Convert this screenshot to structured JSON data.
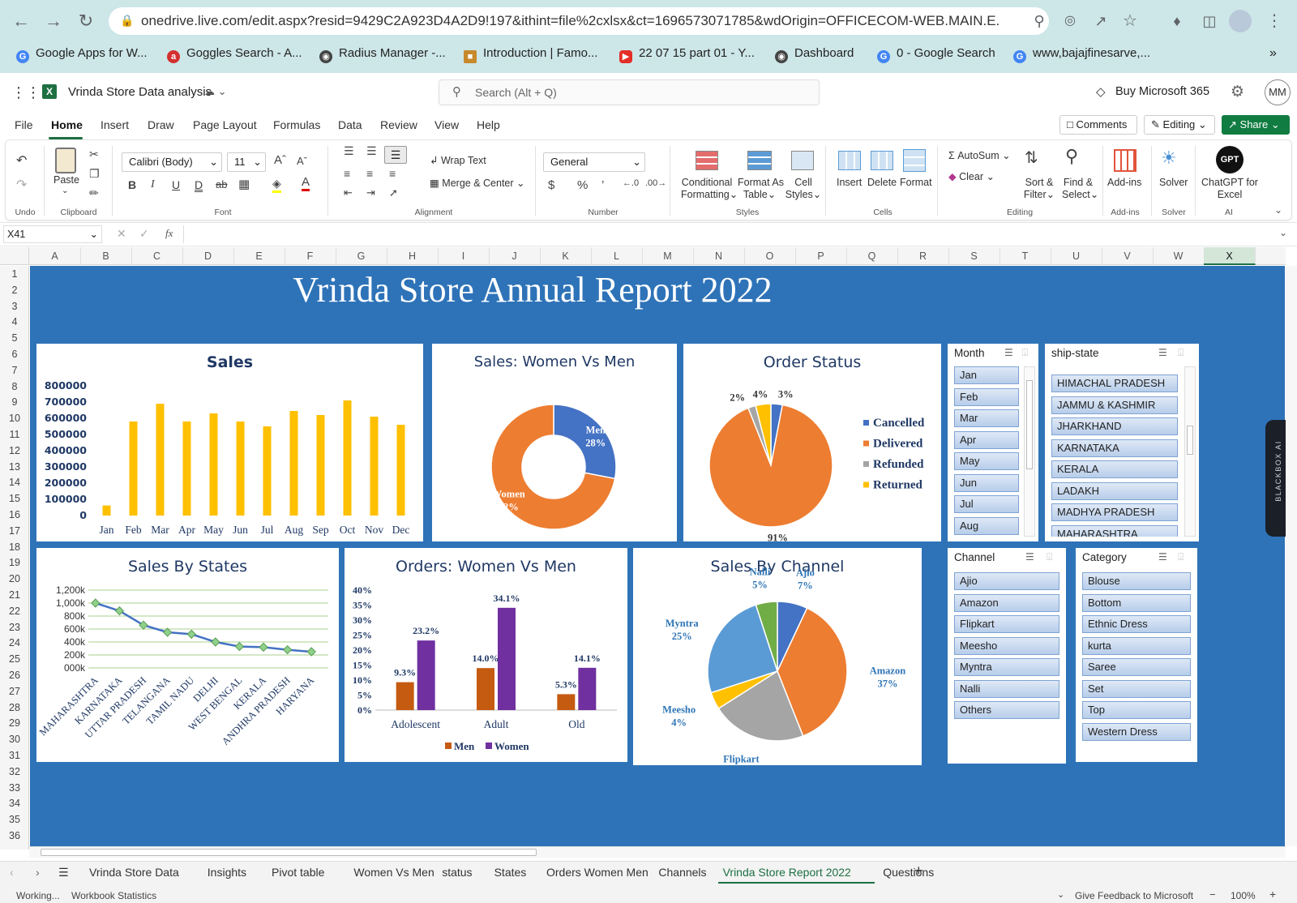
{
  "browser": {
    "url": "onedrive.live.com/edit.aspx?resid=9429C2A923D4A2D9!197&ithint=file%2cxlsx&ct=1696573071785&wdOrigin=OFFICECOM-WEB.MAIN.E...",
    "bookmarks": [
      "Google Apps for W...",
      "Goggles Search - A...",
      "Radius Manager -...",
      "Introduction | Famo...",
      "22 07 15 part 01 - Y...",
      "Dashboard",
      "0 - Google Search",
      "www,bajajfinesarve,..."
    ]
  },
  "app": {
    "doc_title": "Vrinda Store Data analysis",
    "search_placeholder": "Search (Alt + Q)",
    "buy": "Buy Microsoft 365",
    "avatar": "MM"
  },
  "menu": {
    "items": [
      "File",
      "Home",
      "Insert",
      "Draw",
      "Page Layout",
      "Formulas",
      "Data",
      "Review",
      "View",
      "Help"
    ],
    "comments": "Comments",
    "editing": "Editing",
    "share": "Share"
  },
  "ribbon": {
    "undo_group": "Undo",
    "paste": "Paste",
    "clipboard": "Clipboard",
    "font_name": "Calibri (Body)",
    "font_size": "11",
    "font_group": "Font",
    "wrap_text": "Wrap Text",
    "merge_center": "Merge & Center",
    "alignment": "Alignment",
    "number_format": "General",
    "number": "Number",
    "cond_format_1": "Conditional",
    "cond_format_2": "Formatting",
    "format_table_1": "Format As",
    "format_table_2": "Table",
    "cell_styles_1": "Cell",
    "cell_styles_2": "Styles",
    "styles": "Styles",
    "insert": "Insert",
    "delete": "Delete",
    "format": "Format",
    "cells": "Cells",
    "autosum": "AutoSum",
    "clear": "Clear",
    "sort_filter_1": "Sort &",
    "sort_filter_2": "Filter",
    "find_select_1": "Find &",
    "find_select_2": "Select",
    "editing": "Editing",
    "addins": "Add-ins",
    "addins_group": "Add-ins",
    "solver": "Solver",
    "solver_group": "Solver",
    "chatgpt_1": "ChatGPT for",
    "chatgpt_2": "Excel",
    "ai_group": "AI",
    "gpt_badge": "GPT"
  },
  "formula_bar": {
    "name_box": "X41",
    "fx": "fx"
  },
  "grid": {
    "columns": [
      "A",
      "B",
      "C",
      "D",
      "E",
      "F",
      "G",
      "H",
      "I",
      "J",
      "K",
      "L",
      "M",
      "N",
      "O",
      "P",
      "Q",
      "R",
      "S",
      "T",
      "U",
      "V",
      "W",
      "X"
    ],
    "rows": [
      "1",
      "2",
      "3",
      "4",
      "5",
      "6",
      "7",
      "8",
      "9",
      "10",
      "11",
      "12",
      "13",
      "14",
      "15",
      "16",
      "17",
      "18",
      "19",
      "20",
      "21",
      "22",
      "23",
      "24",
      "25",
      "26",
      "27",
      "28",
      "29",
      "30",
      "31",
      "32",
      "33",
      "34",
      "35",
      "36"
    ]
  },
  "dashboard": {
    "title": "Vrinda Store Annual Report 2022"
  },
  "chart_data": [
    {
      "type": "bar",
      "title": "Sales",
      "categories": [
        "Jan",
        "Feb",
        "Mar",
        "Apr",
        "May",
        "Jun",
        "Jul",
        "Aug",
        "Sep",
        "Oct",
        "Nov",
        "Dec"
      ],
      "values": [
        62000,
        580000,
        690000,
        580000,
        630000,
        580000,
        550000,
        645000,
        620000,
        710000,
        610000,
        560000
      ],
      "y_ticks": [
        "0",
        "100000",
        "200000",
        "300000",
        "400000",
        "500000",
        "600000",
        "700000",
        "800000"
      ],
      "ylim": [
        0,
        800000
      ],
      "color": "#ffc000"
    },
    {
      "type": "pie",
      "title": "Sales: Women Vs Men",
      "labels": [
        "Men",
        "Women"
      ],
      "values": [
        28,
        72
      ],
      "value_labels": [
        "28%",
        "72%"
      ],
      "colors": [
        "#4472c4",
        "#ed7d31"
      ],
      "donut": true
    },
    {
      "type": "pie",
      "title": "Order Status",
      "labels": [
        "Cancelled",
        "Delivered",
        "Refunded",
        "Returned"
      ],
      "values": [
        3,
        91,
        2,
        4
      ],
      "value_labels": [
        "3%",
        "91%",
        "2%",
        "4%"
      ],
      "colors": [
        "#4472c4",
        "#ed7d31",
        "#a5a5a5",
        "#ffc000"
      ],
      "legend": "right"
    },
    {
      "type": "line",
      "title": "Sales By States",
      "categories": [
        "MAHARASHTRA",
        "KARNATAKA",
        "UTTAR PRADESH",
        "TELANGANA",
        "TAMIL NADU",
        "DELHI",
        "WEST BENGAL",
        "KERALA",
        "ANDHRA PRADESH",
        "HARYANA"
      ],
      "values": [
        1000000,
        880000,
        660000,
        550000,
        520000,
        400000,
        330000,
        320000,
        280000,
        250000
      ],
      "y_ticks": [
        "000k",
        "200k",
        "400k",
        "600k",
        "800k",
        "1,000k",
        "1,200k"
      ],
      "ylim": [
        0,
        1200000
      ],
      "color": "#4472c4",
      "grid": true
    },
    {
      "type": "bar",
      "title": "Orders: Women Vs Men",
      "categories": [
        "Adolescent",
        "Adult",
        "Old"
      ],
      "series": [
        {
          "name": "Men",
          "values": [
            9.3,
            14.0,
            5.3
          ],
          "labels": [
            "9.3%",
            "14.0%",
            "5.3%"
          ],
          "color": "#c55a11"
        },
        {
          "name": "Women",
          "values": [
            23.2,
            34.1,
            14.1
          ],
          "labels": [
            "23.2%",
            "34.1%",
            "14.1%"
          ],
          "color": "#7030a0"
        }
      ],
      "y_ticks": [
        "0%",
        "5%",
        "10%",
        "15%",
        "20%",
        "25%",
        "30%",
        "35%",
        "40%"
      ],
      "ylim": [
        0,
        40
      ],
      "legend": "bottom"
    },
    {
      "type": "pie",
      "title": "Sales By Channel",
      "labels": [
        "Ajio",
        "Amazon",
        "Flipkart",
        "Meesho",
        "Myntra",
        "Nalli"
      ],
      "values": [
        7,
        37,
        22,
        4,
        25,
        5
      ],
      "value_labels": [
        "7%",
        "37%",
        "22%",
        "4%",
        "25%",
        "5%"
      ],
      "colors": [
        "#4472c4",
        "#ed7d31",
        "#a5a5a5",
        "#ffc000",
        "#5b9bd5",
        "#70ad47"
      ]
    }
  ],
  "slicers": {
    "month": {
      "title": "Month",
      "items": [
        "Jan",
        "Feb",
        "Mar",
        "Apr",
        "May",
        "Jun",
        "Jul",
        "Aug"
      ]
    },
    "state": {
      "title": "ship-state",
      "items": [
        "HIMACHAL PRADESH",
        "JAMMU & KASHMIR",
        "JHARKHAND",
        "KARNATAKA",
        "KERALA",
        "LADAKH",
        "MADHYA PRADESH",
        "MAHARASHTRA"
      ]
    },
    "channel": {
      "title": "Channel",
      "items": [
        "Ajio",
        "Amazon",
        "Flipkart",
        "Meesho",
        "Myntra",
        "Nalli",
        "Others"
      ]
    },
    "category": {
      "title": "Category",
      "items": [
        "Blouse",
        "Bottom",
        "Ethnic Dress",
        "kurta",
        "Saree",
        "Set",
        "Top",
        "Western Dress"
      ]
    }
  },
  "side_tab": "BLACKBOX AI",
  "sheets": [
    "Vrinda Store Data",
    "Insights",
    "Pivot table",
    "Women Vs Men",
    "status",
    "States",
    "Orders Women Men",
    "Channels",
    "Vrinda Store Report 2022",
    "Questions"
  ],
  "active_sheet": "Vrinda Store Report 2022",
  "status": {
    "left1": "Working...",
    "left2": "Workbook Statistics",
    "feedback": "Give Feedback to Microsoft",
    "zoom": "100%"
  }
}
